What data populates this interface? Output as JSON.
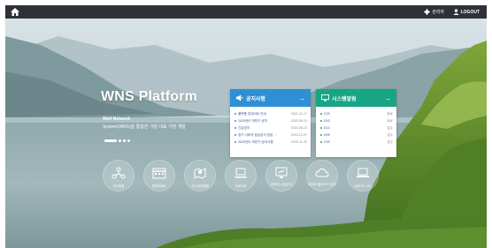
{
  "topbar": {
    "home_icon": "home-icon",
    "admin_label": "관리자",
    "logout_label": "LOGOUT"
  },
  "hero": {
    "title": "WNS Platform",
    "subtitle_line1": "Well Network",
    "subtitle_line2": "System(WNS)을 통합한 가장 대표 가장 개발"
  },
  "notice": {
    "title": "공지사항",
    "more": "→",
    "items": [
      {
        "title": "플랫폼 업데이트 안내",
        "date": "2021-11-17"
      },
      {
        "title": "2020년도 하반기 공지",
        "date": "2020-08-13"
      },
      {
        "title": "긴급공지",
        "date": "2020-08-13"
      },
      {
        "title": "정기 서버의 점검공지 업된 …",
        "date": "2020-12-07"
      },
      {
        "title": "2020년도 하반기 공지사항",
        "date": "2020-11-30"
      }
    ]
  },
  "system": {
    "title": "시스템알림",
    "more": "→",
    "items": [
      {
        "code": "C03",
        "status": "완료"
      },
      {
        "code": "D02",
        "status": "완료"
      },
      {
        "code": "D14",
        "status": "접수"
      },
      {
        "code": "D05",
        "status": "접수"
      },
      {
        "code": "C05",
        "status": "접수"
      }
    ]
  },
  "quick_links": [
    {
      "label": "관리현황",
      "icon": "network-icon"
    },
    {
      "label": "현장체계도",
      "icon": "calendar-icon"
    },
    {
      "label": "공사공정현황",
      "icon": "map-icon"
    },
    {
      "label": "자료조회",
      "icon": "laptop-icon"
    },
    {
      "label": "데이터 수집분석",
      "icon": "monitor-icon"
    },
    {
      "label": "데이터 클라우드 분석",
      "icon": "cloud-icon"
    },
    {
      "label": "MODFLOW",
      "icon": "computer-icon"
    }
  ],
  "colors": {
    "topbar": "#2e3138",
    "notice_header": "#2f8fd4",
    "system_header": "#17a583"
  }
}
